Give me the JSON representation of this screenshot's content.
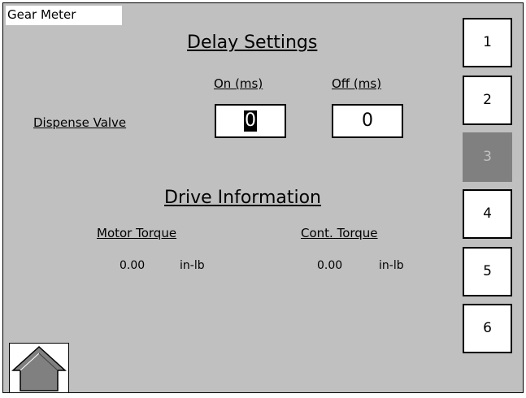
{
  "app": {
    "title": "Gear Meter"
  },
  "delay_settings": {
    "heading": "Delay Settings",
    "col_on": "On (ms)",
    "col_off": "Off (ms)",
    "row_label": "Dispense Valve",
    "on_value": "0",
    "off_value": "0"
  },
  "drive_info": {
    "heading": "Drive Information",
    "motor_torque_label": "Motor Torque",
    "motor_torque_value": "0.00",
    "motor_torque_unit": "in-lb",
    "cont_torque_label": "Cont. Torque",
    "cont_torque_value": "0.00",
    "cont_torque_unit": "in-lb"
  },
  "nav": {
    "buttons": [
      "1",
      "2",
      "3",
      "4",
      "5",
      "6"
    ],
    "active_index": 2
  },
  "home": {
    "icon": "house-icon"
  },
  "colors": {
    "background": "#c0c0c0",
    "active_button": "#808080",
    "field": "#ffffff"
  }
}
